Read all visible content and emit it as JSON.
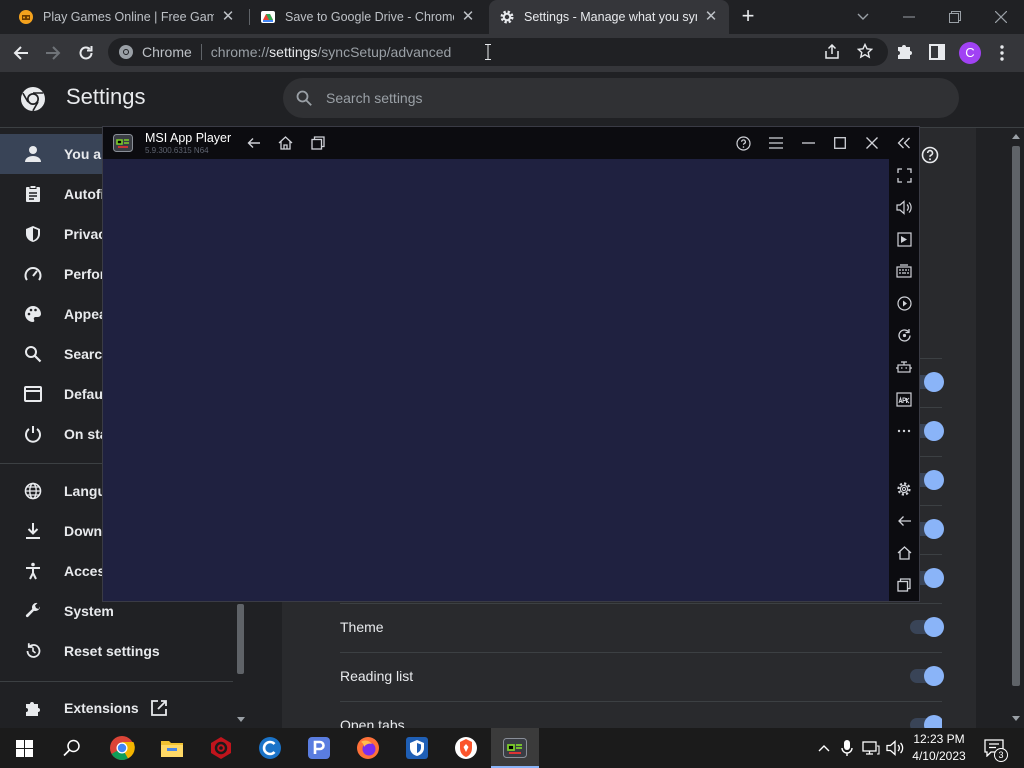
{
  "browser": {
    "tabs": [
      {
        "title": "Play Games Online | Free Games",
        "favicon": "game-favicon",
        "close": "✕"
      },
      {
        "title": "Save to Google Drive - Chrome W",
        "favicon": "drive-favicon",
        "close": "✕"
      },
      {
        "title": "Settings - Manage what you sync",
        "favicon": "gear-favicon",
        "close": "✕",
        "active": true
      }
    ],
    "new_tab": "+",
    "omnibox": {
      "chip": "Chrome",
      "url_prefix": "chrome://",
      "url_bold": "settings",
      "url_suffix": "/syncSetup/advanced"
    },
    "profile_initial": "C"
  },
  "settings": {
    "title": "Settings",
    "search_placeholder": "Search settings",
    "nav": [
      {
        "label": "You ar",
        "icon": "person-icon",
        "selected": true
      },
      {
        "label": "Autofi",
        "icon": "autofill-icon"
      },
      {
        "label": "Privac",
        "icon": "shield-icon"
      },
      {
        "label": "Perfor",
        "icon": "speedometer-icon"
      },
      {
        "label": "Appea",
        "icon": "palette-icon"
      },
      {
        "label": "Search",
        "icon": "search-icon"
      },
      {
        "label": "Defau",
        "icon": "browser-icon"
      },
      {
        "label": "On sta",
        "icon": "power-icon"
      },
      {
        "label": "Langu",
        "icon": "globe-icon"
      },
      {
        "label": "Downl",
        "icon": "download-icon"
      },
      {
        "label": "Acces",
        "icon": "accessibility-icon"
      },
      {
        "label": "System",
        "icon": "wrench-icon"
      },
      {
        "label": "Reset settings",
        "icon": "reset-icon"
      },
      {
        "label": "Extensions",
        "icon": "puzzle-icon"
      }
    ],
    "sync_rows": [
      {
        "label": "",
        "on": true
      },
      {
        "label": "",
        "on": true
      },
      {
        "label": "",
        "on": true
      },
      {
        "label": "",
        "on": true
      },
      {
        "label": "",
        "on": true
      },
      {
        "label": "Theme",
        "on": true
      },
      {
        "label": "Reading list",
        "on": true
      },
      {
        "label": "Open tabs",
        "on": true
      }
    ]
  },
  "msi_player": {
    "title": "MSI App Player",
    "version": "5.9.300.6315  N64"
  },
  "taskbar": {
    "apps": [
      "start-icon",
      "search-icon",
      "chrome-icon",
      "file-explorer-icon",
      "red-app-icon",
      "ccleaner-icon",
      "p-app-icon",
      "firefox-icon",
      "shield-app-icon",
      "brave-icon",
      "msi-app-player-icon"
    ],
    "time": "12:23 PM",
    "date": "4/10/2023",
    "notifications": "3"
  },
  "colors": {
    "accent": "#8ab4f8",
    "profile": "#a142f4",
    "msi_screen": "#1f2140"
  }
}
